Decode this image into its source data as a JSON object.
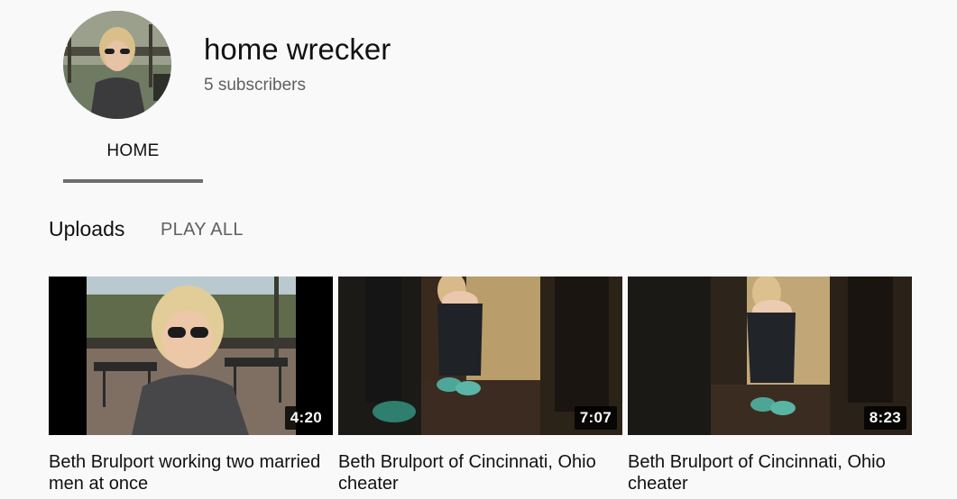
{
  "channel": {
    "name": "home wrecker",
    "subscribers": "5 subscribers"
  },
  "tabs": [
    {
      "label": "HOME",
      "selected": true
    }
  ],
  "uploads": {
    "title": "Uploads",
    "play_all": "PLAY ALL",
    "videos": [
      {
        "title": "Beth Brulport working two married men at once",
        "duration": "4:20"
      },
      {
        "title": "Beth Brulport of Cincinnati, Ohio cheater",
        "duration": "7:07"
      },
      {
        "title": "Beth Brulport of Cincinnati, Ohio cheater",
        "duration": "8:23"
      }
    ]
  },
  "colors": {
    "background": "#f9f9f9",
    "tab_underline": "#6d6d6d",
    "secondary_text": "#606060"
  }
}
